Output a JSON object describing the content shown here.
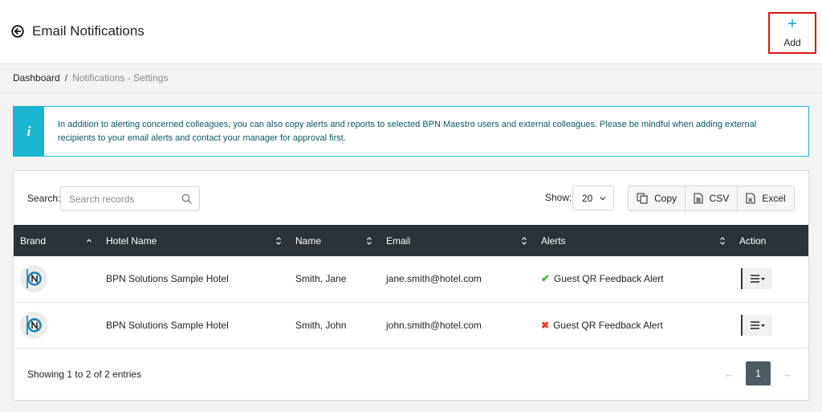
{
  "header": {
    "title": "Email Notifications",
    "add_label": "Add",
    "add_plus": "+"
  },
  "breadcrumb": {
    "home": "Dashboard",
    "separator": "/",
    "current": "Notifications - Settings"
  },
  "info": {
    "icon": "i",
    "text": "In addition to alerting concerned colleagues, you can also copy alerts and reports to selected BPN Maestro users and external colleagues. Please be mindful when adding external recipients to your email alerts and contact your manager for approval first."
  },
  "toolbar": {
    "search_label": "Search:",
    "search_placeholder": "Search records",
    "search_value": "",
    "show_label": "Show:",
    "show_value": "20",
    "copy_label": "Copy",
    "csv_label": "CSV",
    "excel_label": "Excel"
  },
  "table": {
    "columns": [
      "Brand",
      "Hotel Name",
      "Name",
      "Email",
      "Alerts",
      "Action"
    ],
    "rows": [
      {
        "hotel": "BPN Solutions Sample Hotel",
        "name": "Smith, Jane",
        "email": "jane.smith@hotel.com",
        "alert": "Guest QR Feedback Alert",
        "alert_symbol": "✔",
        "alert_status": "enabled"
      },
      {
        "hotel": "BPN Solutions Sample Hotel",
        "name": "Smith, John",
        "email": "john.smith@hotel.com",
        "alert": "Guest QR Feedback Alert",
        "alert_symbol": "✖",
        "alert_status": "disabled"
      }
    ]
  },
  "footer": {
    "info": "Showing 1 to 2 of 2 entries",
    "current_page": "1",
    "prev_symbol": "←",
    "next_symbol": "→"
  },
  "colors": {
    "accent": "#19b5d1",
    "table_header": "#2b3338",
    "add_highlight": "#d9141a",
    "ok": "#4aae3c",
    "error": "#e4392b"
  },
  "icons": {
    "back": "back-arrow-circle-icon",
    "info": "info-icon",
    "search": "search-icon",
    "copy": "copy-icon",
    "csv": "csv-file-icon",
    "excel": "excel-file-icon",
    "action": "menu-dropdown-icon",
    "brand": "bpn-logo"
  }
}
